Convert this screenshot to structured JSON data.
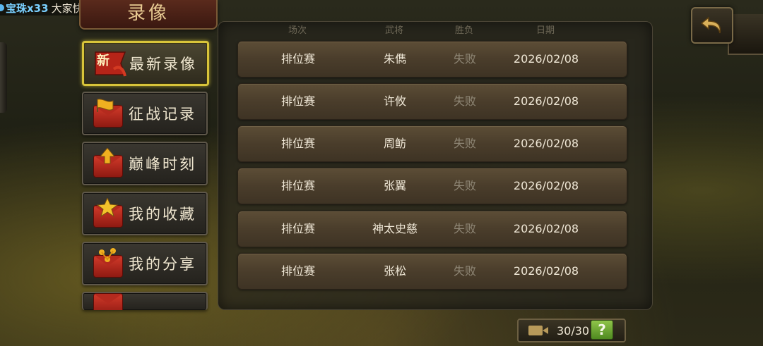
{
  "ticker": {
    "highlight": "宝珠x33",
    "message": "大家快恭喜TA吧"
  },
  "title": "录像",
  "menu": [
    {
      "label": "最新录像",
      "badge": "新",
      "active": true
    },
    {
      "label": "征战记录",
      "active": false
    },
    {
      "label": "巅峰时刻",
      "active": false
    },
    {
      "label": "我的收藏",
      "active": false
    },
    {
      "label": "我的分享",
      "active": false
    },
    {
      "label": "",
      "active": false
    }
  ],
  "columns": {
    "mode": "场次",
    "general": "武将",
    "result": "胜负",
    "date": "日期"
  },
  "records": [
    {
      "mode": "排位赛",
      "general": "朱儁",
      "result": "失败",
      "date": "2026/02/08"
    },
    {
      "mode": "排位赛",
      "general": "许攸",
      "result": "失败",
      "date": "2026/02/08"
    },
    {
      "mode": "排位赛",
      "general": "周鲂",
      "result": "失败",
      "date": "2026/02/08"
    },
    {
      "mode": "排位赛",
      "general": "张翼",
      "result": "失败",
      "date": "2026/02/08"
    },
    {
      "mode": "排位赛",
      "general": "神太史慈",
      "result": "失败",
      "date": "2026/02/08"
    },
    {
      "mode": "排位赛",
      "general": "张松",
      "result": "失败",
      "date": "2026/02/08"
    }
  ],
  "storage": {
    "count": "30/30"
  },
  "help_label": "?",
  "colors": {
    "active_border": "#d8c43a",
    "result_lose": "#8f8776",
    "help_green": "#6aa836"
  }
}
